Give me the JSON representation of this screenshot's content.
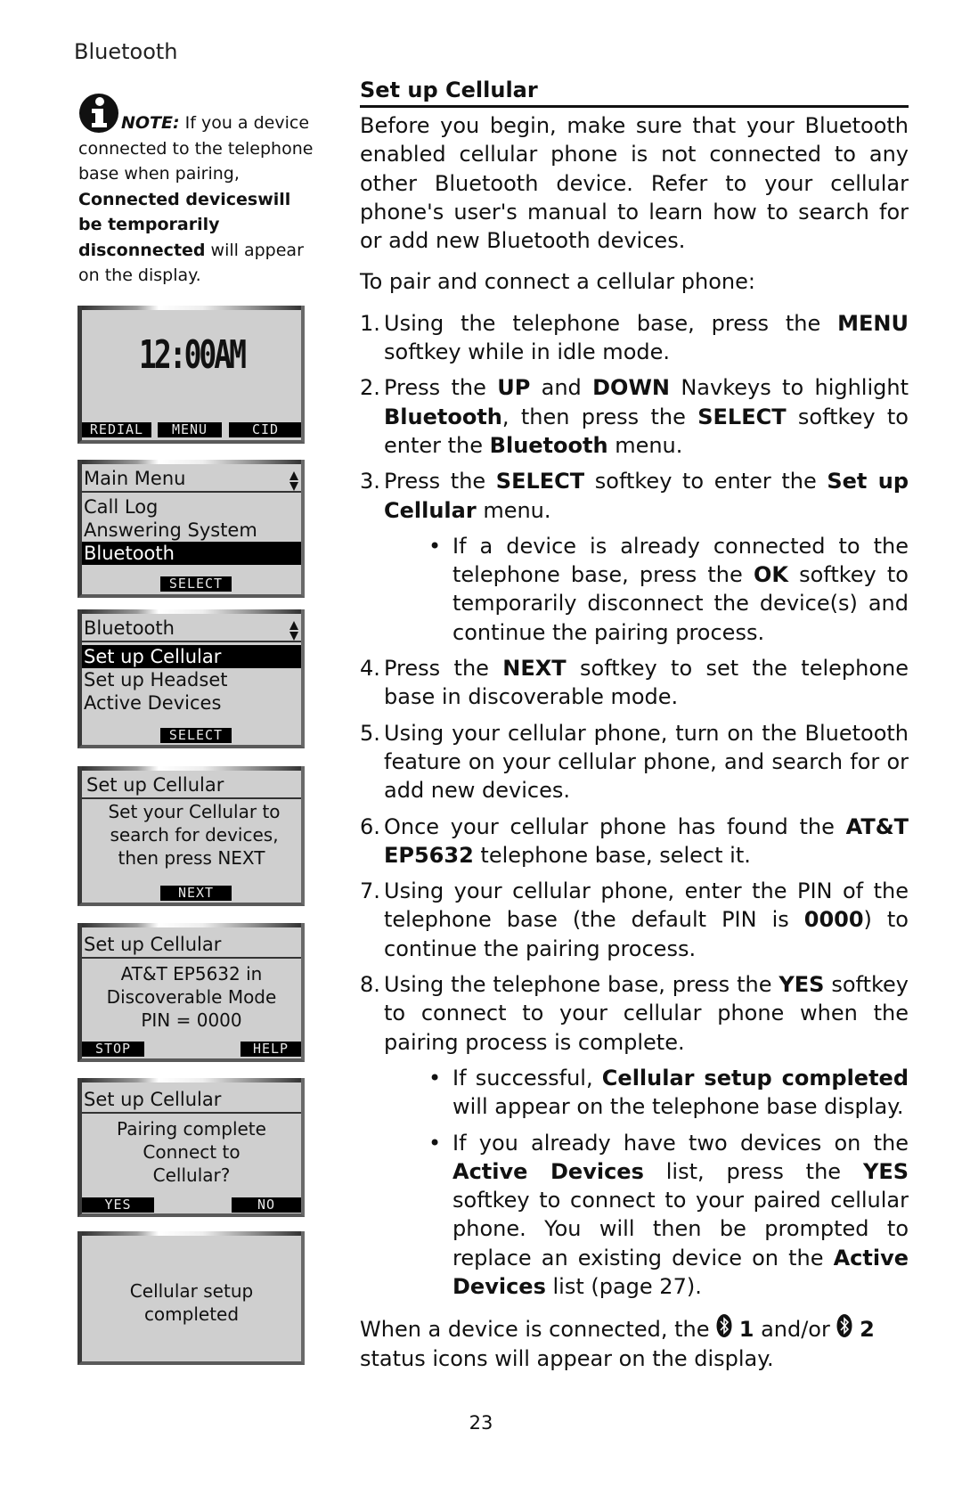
{
  "section_label": "Bluetooth",
  "note": {
    "icon": "info-icon",
    "label": "NOTE:",
    "text_1": " If you a device connected to the telephone base when pairing, ",
    "bold_1": "Connected deviceswill be temporarily disconnected",
    "text_2": " will appear on the display."
  },
  "screens": [
    {
      "name": "idle-screen",
      "clock": "12:00AM",
      "softkeys": [
        "REDIAL",
        "MENU",
        "CID"
      ]
    },
    {
      "name": "main-menu-screen",
      "title": "Main Menu",
      "items": [
        "Call Log",
        "Answering System",
        "Bluetooth"
      ],
      "selected_index": 2,
      "softkey": "SELECT"
    },
    {
      "name": "bluetooth-menu-screen",
      "title": "Bluetooth",
      "items": [
        "Set up Cellular",
        "Set up Headset",
        "Active Devices"
      ],
      "selected_index": 0,
      "softkey": "SELECT"
    },
    {
      "name": "setup-search-screen",
      "title": "Set up Cellular",
      "lines": [
        "Set your Cellular to",
        "search for devices,",
        "then press NEXT"
      ],
      "softkey": "NEXT"
    },
    {
      "name": "discoverable-screen",
      "title": "Set up Cellular",
      "lines": [
        "AT&T EP5632 in",
        "Discoverable Mode",
        "PIN = 0000"
      ],
      "softkeys": [
        "STOP",
        "HELP"
      ]
    },
    {
      "name": "pairing-complete-screen",
      "title": "Set up Cellular",
      "lines": [
        "Pairing complete",
        "Connect to",
        "Cellular?"
      ],
      "softkeys": [
        "YES",
        "NO"
      ]
    },
    {
      "name": "setup-completed-screen",
      "lines": [
        "Cellular setup",
        "completed"
      ]
    }
  ],
  "main": {
    "heading": "Set up Cellular",
    "intro": "Before you begin, make sure that your Bluetooth enabled cellular phone is not connected to any other Bluetooth device. Refer to your cellular phone's user's manual to learn how to search for or add new Bluetooth devices.",
    "lead": "To pair and connect a cellular phone:",
    "steps": [
      {
        "num": "1.",
        "parts": [
          "Using the telephone base, press the ",
          "MENU",
          " softkey while in idle mode."
        ]
      },
      {
        "num": "2.",
        "parts": [
          "Press the ",
          "UP",
          " and ",
          "DOWN",
          " Navkeys to highlight ",
          "Bluetooth",
          ", then press the ",
          "SELECT",
          " softkey to enter the ",
          "Bluetooth",
          " menu."
        ]
      },
      {
        "num": "3.",
        "parts": [
          "Press the ",
          "SELECT",
          " softkey to enter the ",
          "Set up Cellular",
          " menu."
        ],
        "bullets": [
          {
            "parts": [
              "If a device is already connected to the telephone base, press the ",
              "OK",
              " softkey to temporarily disconnect the device(s) and continue the pairing process."
            ]
          }
        ]
      },
      {
        "num": "4.",
        "parts": [
          "Press the ",
          "NEXT",
          " softkey to set the telephone base in discoverable mode."
        ]
      },
      {
        "num": "5.",
        "parts": [
          "Using your cellular phone, turn on the Bluetooth feature on your cellular phone, and search for or add new devices."
        ]
      },
      {
        "num": "6.",
        "parts": [
          "Once your cellular phone has found the ",
          "AT&T EP5632",
          " telephone base, select it."
        ]
      },
      {
        "num": "7.",
        "parts": [
          "Using your cellular phone, enter the PIN of the telephone base (the default PIN is ",
          "0000",
          ") to continue the pairing process."
        ]
      },
      {
        "num": "8.",
        "parts": [
          "Using the telephone base, press the ",
          "YES",
          " softkey to connect to your cellular phone when the pairing process is complete."
        ],
        "bullets": [
          {
            "parts": [
              "If successful, ",
              "Cellular setup completed",
              " will appear on the telephone base display."
            ]
          },
          {
            "parts": [
              "If you already have two devices on the ",
              "Active Devices",
              " list, press the ",
              "YES",
              " softkey to connect to your paired cellular phone. You will then be prompted to replace an existing device on the ",
              "Active Devices",
              " list (page 27)."
            ]
          }
        ]
      }
    ],
    "closing": {
      "text_1": "When a device is connected, the ",
      "icon_1": "bluetooth-icon",
      "bold_1": "1",
      "text_2": " and/or ",
      "icon_2": "bluetooth-icon",
      "bold_2": "2",
      "text_3": " status icons will appear on the display."
    }
  },
  "page_number": "23"
}
